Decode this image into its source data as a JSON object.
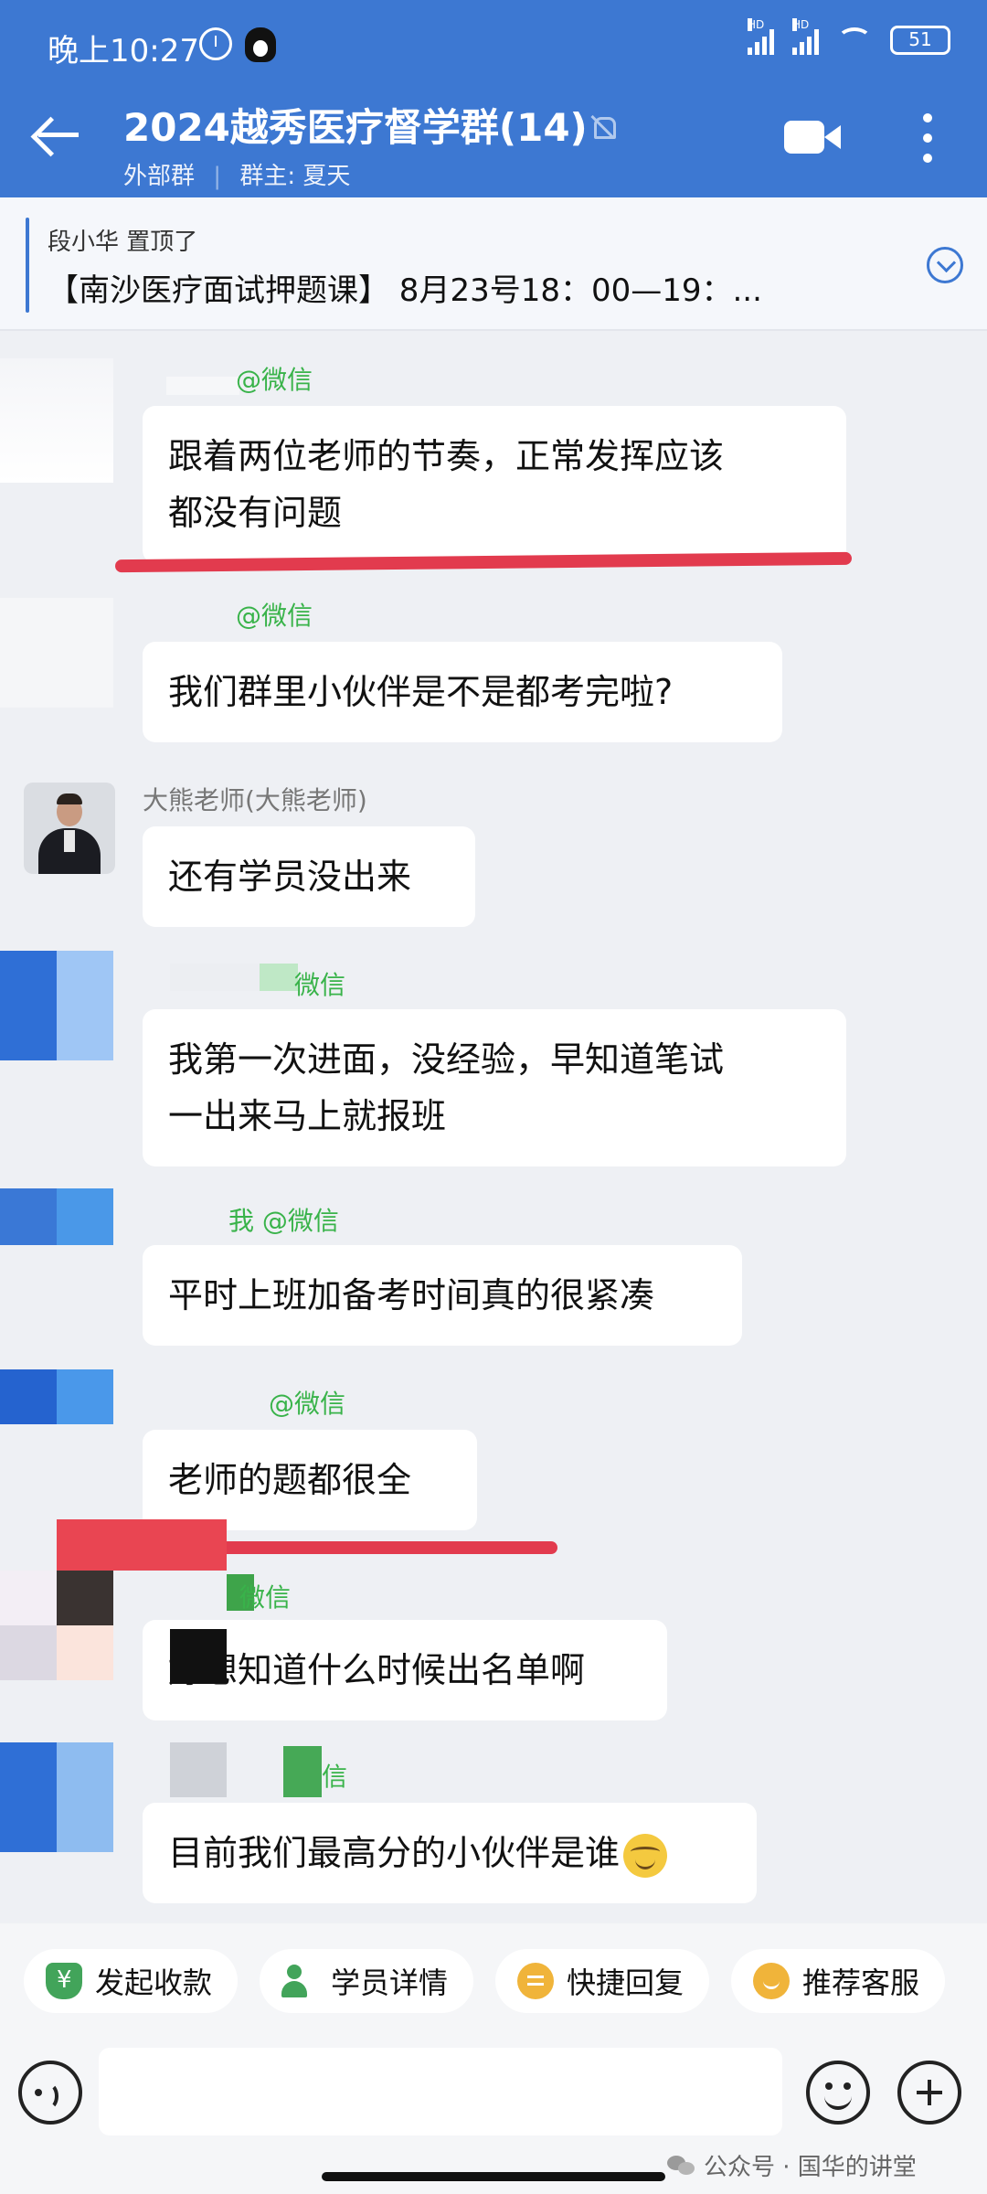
{
  "status_bar": {
    "time": "晚上10:27",
    "hd1": "HD",
    "hd2": "HD",
    "battery": "51"
  },
  "header": {
    "title": "2024越秀医疗督学群(14)",
    "subtitle_type": "外部群",
    "subtitle_sep": "|",
    "subtitle_owner": "群主: 夏天",
    "accent_color": "#3d78d2"
  },
  "pinned": {
    "author": "段小华 置顶了",
    "text": "【南沙医疗面试押题课】 8月23号18：00—19：..."
  },
  "messages": [
    {
      "sender": "@微信",
      "text_lines": [
        "跟着两位老师的节奏，正常发挥应该",
        "都没有问题"
      ]
    },
    {
      "sender": "@微信",
      "text_lines": [
        "我们群里小伙伴是不是都考完啦?"
      ]
    },
    {
      "sender": "大熊老师(大熊老师)",
      "text_lines": [
        "还有学员没出来"
      ]
    },
    {
      "sender": "微信",
      "text_lines": [
        "我第一次进面，没经验，早知道笔试",
        "一出来马上就报班"
      ]
    },
    {
      "sender": "我 @微信",
      "text_lines": [
        "平时上班加备考时间真的很紧凑"
      ]
    },
    {
      "sender": "@微信",
      "text_lines": [
        "老师的题都很全"
      ]
    },
    {
      "sender": "微信",
      "text_lines": [
        "好想知道什么时候出名单啊"
      ]
    },
    {
      "sender": "信",
      "text_lines": [
        "目前我们最高分的小伙伴是谁"
      ],
      "emoji": "smirk-face"
    }
  ],
  "quick_actions": [
    {
      "label": "发起收款",
      "icon": "payment-icon"
    },
    {
      "label": "学员详情",
      "icon": "user-detail-icon"
    },
    {
      "label": "快捷回复",
      "icon": "quick-reply-icon"
    },
    {
      "label": "推荐客服",
      "icon": "service-icon"
    }
  ],
  "input": {
    "placeholder": ""
  },
  "watermark": "公众号 · 国华的讲堂",
  "colors": {
    "highlight_red": "#e23b4e",
    "sender_green": "#39b34a",
    "pin_icon_green": "#42a45a",
    "quick_icon_yellow": "#f0b43a"
  }
}
